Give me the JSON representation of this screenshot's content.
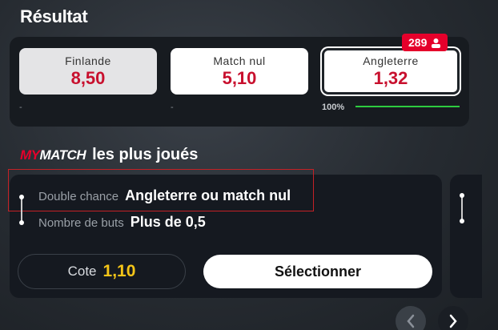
{
  "section_result": {
    "title": "Résultat"
  },
  "odds": [
    {
      "label": "Finlande",
      "value": "8,50",
      "footer": "-"
    },
    {
      "label": "Match nul",
      "value": "5,10",
      "footer": "-"
    },
    {
      "label": "Angleterre",
      "value": "1,32",
      "footer": "100%"
    }
  ],
  "badge": {
    "count": "289",
    "icon": "user-icon"
  },
  "mymatch": {
    "logo_my": "MY",
    "logo_match": "MATCH",
    "title": "les plus joués",
    "selections": [
      {
        "label": "Double chance",
        "value": "Angleterre ou match nul"
      },
      {
        "label": "Nombre de buts",
        "value": "Plus de 0,5"
      }
    ],
    "cote_label": "Cote",
    "cote_value": "1,10",
    "select_label": "Sélectionner"
  },
  "colors": {
    "accent_red": "#e5002b",
    "odd_red": "#c8102e",
    "cote_yellow": "#f5c518",
    "progress_green": "#2ecc40"
  },
  "progress": {
    "angleterre_percent": 100
  }
}
